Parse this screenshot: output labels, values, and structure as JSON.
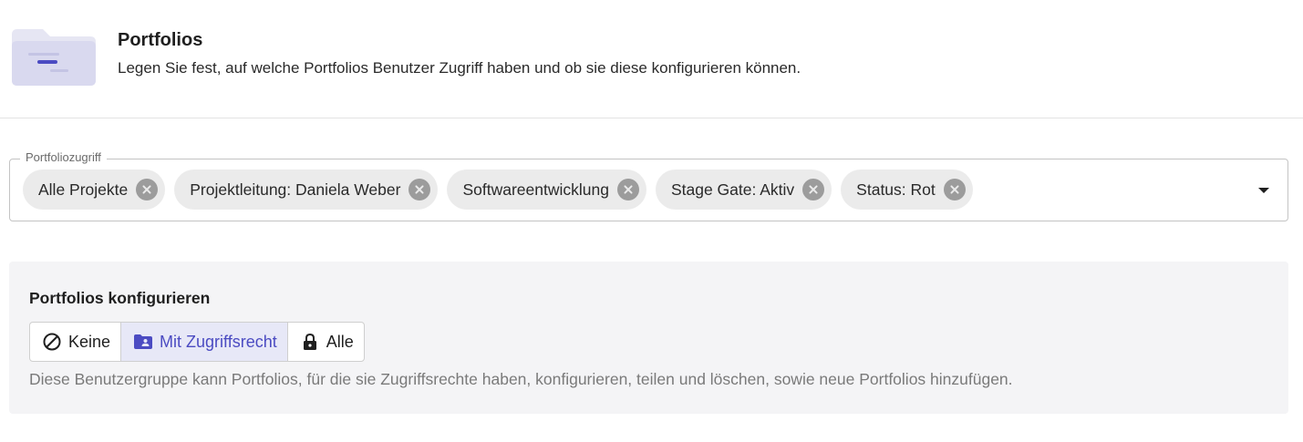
{
  "header": {
    "title": "Portfolios",
    "description": "Legen Sie fest, auf welche Portfolios Benutzer Zugriff haben und ob sie diese konfigurieren können.",
    "illustration_icon": "folder-filter-icon"
  },
  "portfolio_access": {
    "label": "Portfoliozugriff",
    "chips": [
      {
        "label": "Alle Projekte"
      },
      {
        "label": "Projektleitung: Daniela Weber"
      },
      {
        "label": "Softwareentwicklung"
      },
      {
        "label": "Stage Gate: Aktiv"
      },
      {
        "label": "Status: Rot"
      }
    ]
  },
  "configure": {
    "title": "Portfolios konfigurieren",
    "options": [
      {
        "label": "Keine",
        "icon": "block-icon",
        "selected": false
      },
      {
        "label": "Mit Zugriffsrecht",
        "icon": "folder-shared-icon",
        "selected": true
      },
      {
        "label": "Alle",
        "icon": "lock-icon",
        "selected": false
      }
    ],
    "help_text": "Diese Benutzergruppe kann Portfolios, für die sie Zugriffsrechte haben, konfigurieren, teilen und löschen, sowie neue Portfolios hinzufügen."
  },
  "colors": {
    "accent": "#4b4bc2",
    "selected_bg": "#e7e8f7",
    "chip_bg": "#ebebeb",
    "panel_bg": "#f4f4f6"
  }
}
